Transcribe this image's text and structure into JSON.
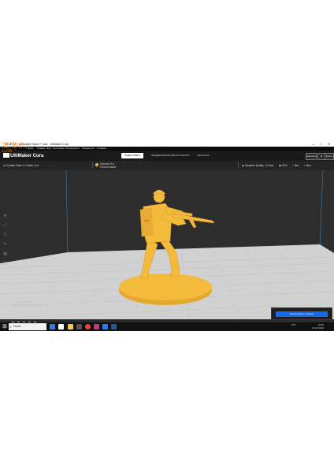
{
  "window": {
    "title": "CE3E3V2_soulsoldier figure + rase - UltiMaker Cura",
    "controls": [
      "—",
      "□",
      "✕"
    ]
  },
  "menubar": {
    "items": [
      "Файл",
      "Правка",
      "Вид",
      "Настройки",
      "Расширения",
      "Параметры",
      "Справка"
    ]
  },
  "overlay": {
    "fps_line1": "285 FPS  28",
    "fps_line2": "2901 MB  47.4°",
    "fps_line3": "11/95 °"
  },
  "header": {
    "logo": "UltiMaker Cura",
    "stages": [
      "ПОДГОТОВКА",
      "ПРЕДВАРИТЕЛЬНЫЙ ПРОСМОТР",
      "МОНИТОР"
    ],
    "active_stage": 0,
    "marketplace_label": "Магазин",
    "signin_label": "Войти"
  },
  "toolbar": {
    "printer": "Creality Ender-3 / Ender-3 v2",
    "material_top": "Generic PLA",
    "material_bottom": "0.4mm Nozzle",
    "quality": "Standard Quality - 0.2mm",
    "infill": "20%",
    "support": "Вкл",
    "adhesion": "Вкл"
  },
  "object_list": {
    "header": "Список объектов",
    "item": "CE3E3V2_soulsoldier figure + rase"
  },
  "slice": {
    "button": "Подготовить к печати"
  },
  "taskbar": {
    "search_placeholder": "Поиск",
    "time": "19:32",
    "date": "13.02.2024",
    "lang": "РУС"
  },
  "colors": {
    "model": "#f4ba3c",
    "accent": "#1968e5",
    "background": "#2d2d2d"
  }
}
